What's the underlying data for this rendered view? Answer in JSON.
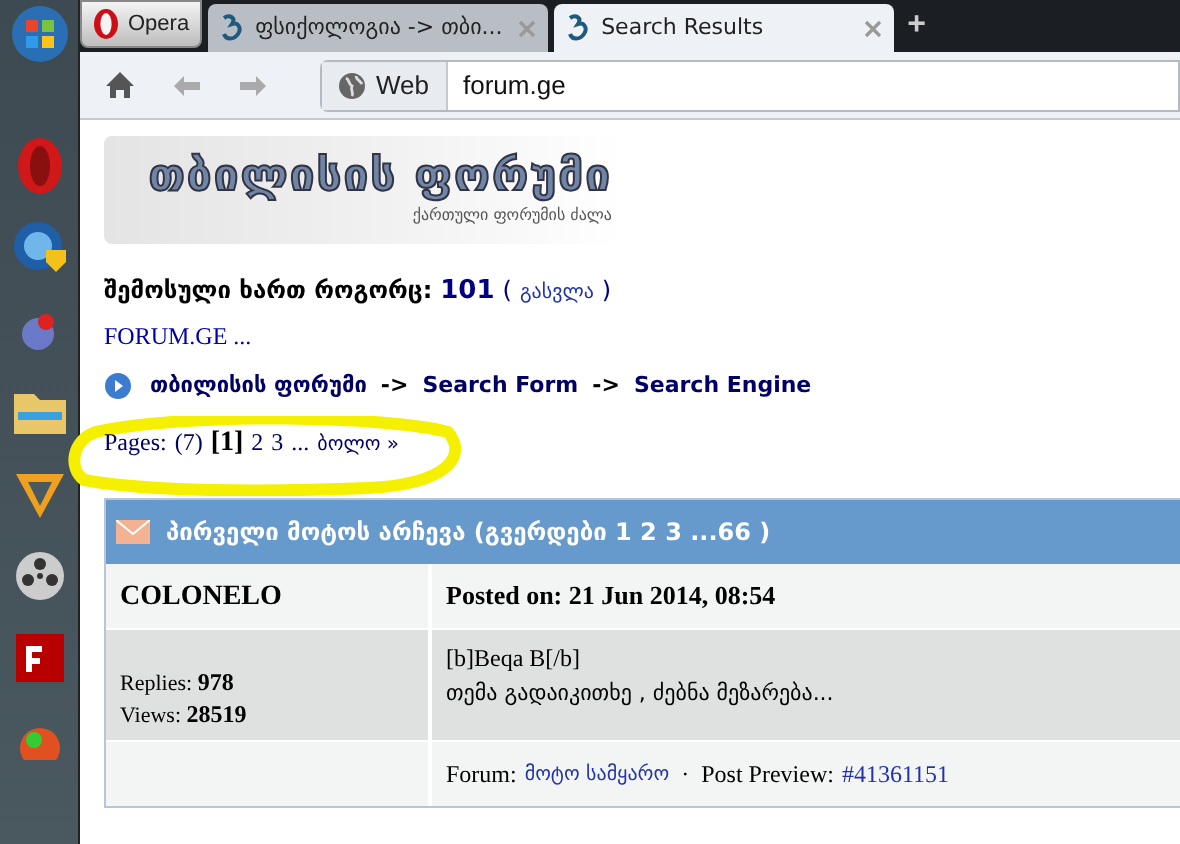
{
  "browser": {
    "opera_button": "Opera",
    "tabs": [
      {
        "title": "ფსიქოლოგია -> თბი...",
        "selected": false
      },
      {
        "title": "Search Results",
        "selected": true
      }
    ],
    "new_tab": "+",
    "toolbar": {
      "search_engine": "Web",
      "address": "forum.ge"
    }
  },
  "page": {
    "logo": {
      "title": "თბილისის ფორუმი",
      "subtitle": "ქართული ფორუმის ძალა"
    },
    "login_line": {
      "label": "შემოსული ხართ როგორც:",
      "user": "101",
      "open": "(",
      "logout": "გასვლა",
      "close": ")"
    },
    "site_link": "FORUM.GE ...",
    "breadcrumb": [
      "თბილისის ფორუმი",
      "->",
      "Search Form",
      "->",
      "Search Engine"
    ],
    "pages": {
      "label": "Pages:",
      "count": "(7)",
      "current": "[1]",
      "links": [
        "2",
        "3"
      ],
      "ellipsis": "...",
      "last": "ბოლო »"
    },
    "topic": {
      "title": "პირველი მოტოს არჩევა (გვერდები 1 2 3 ...66 )",
      "author": "COLONELO",
      "posted": "Posted on: 21 Jun 2014, 08:54",
      "replies_label": "Replies:",
      "replies": "978",
      "views_label": "Views:",
      "views": "28519",
      "body": [
        "[b]Beqa B[/b]",
        "თემა გადაიკითხე , ძებნა მეზარება..."
      ],
      "forum_label": "Forum:",
      "forum": "მოტო სამყარო",
      "separator": "·",
      "preview_label": "Post Preview:",
      "preview": "#41361151"
    }
  }
}
